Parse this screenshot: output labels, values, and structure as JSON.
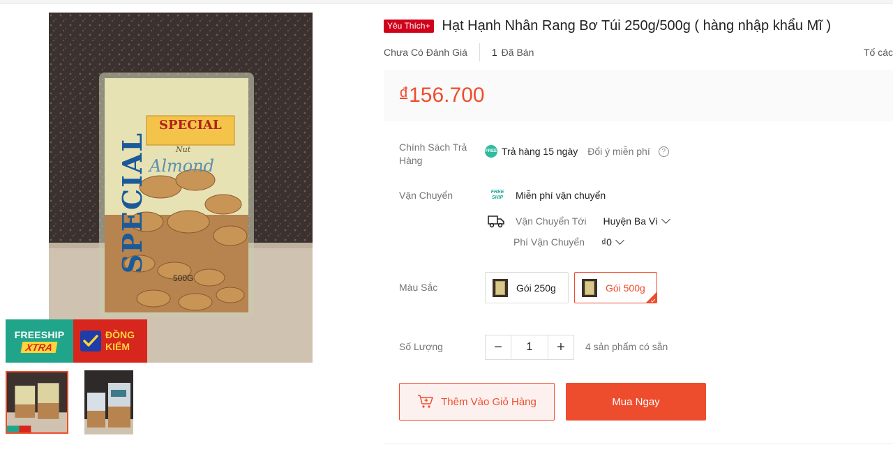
{
  "gallery": {
    "main_image_alt": "",
    "badges": {
      "freeship_top": "FREESHIP",
      "freeship_bottom": "XTRA",
      "dongkiem_line1": "ĐỒNG",
      "dongkiem_line2": "KIỂM"
    },
    "package_text": {
      "brand": "SPECIAL",
      "sub": "Nut",
      "product": "Almond",
      "weight": "500G",
      "side": "SPECIAL"
    }
  },
  "product": {
    "favorite_badge": "Yêu Thích+",
    "title": "Hạt Hạnh Nhân Rang Bơ Túi 250g/500g ( hàng nhập khẩu Mĩ )",
    "rating_text": "Chưa Có Đánh Giá",
    "sold_count": "1",
    "sold_label": "Đã Bán",
    "report_text": "Tố các",
    "price_currency": "đ",
    "price": "156.700"
  },
  "return_policy": {
    "label": "Chính Sách Trả Hàng",
    "icon_text": "FREE",
    "days": "Trả hàng 15 ngày",
    "change_mind": "Đổi ý miễn phí",
    "help_icon": "?"
  },
  "shipping": {
    "label": "Vận Chuyển",
    "free_icon_top": "FREE",
    "free_icon_bottom": "SHIP",
    "free_text": "Miễn phí vận chuyển",
    "to_label": "Vận Chuyển Tới",
    "to_value": "Huyện Ba Vì",
    "fee_label": "Phí Vận Chuyển",
    "fee_value": "₫0"
  },
  "color": {
    "label": "Màu Sắc",
    "options": [
      {
        "label": "Gói 250g",
        "selected": false
      },
      {
        "label": "Gói 500g",
        "selected": true
      }
    ]
  },
  "quantity": {
    "label": "Số Lượng",
    "minus": "−",
    "value": "1",
    "plus": "+",
    "stock": "4 sản phẩm có sẵn"
  },
  "actions": {
    "add_to_cart": "Thêm Vào Giỏ Hàng",
    "buy_now": "Mua Ngay"
  },
  "colors": {
    "accent": "#ee4d2d",
    "favorite_badge": "#d0011b",
    "freeship_green": "#21a58a",
    "dongkiem_red": "#d7261d"
  }
}
